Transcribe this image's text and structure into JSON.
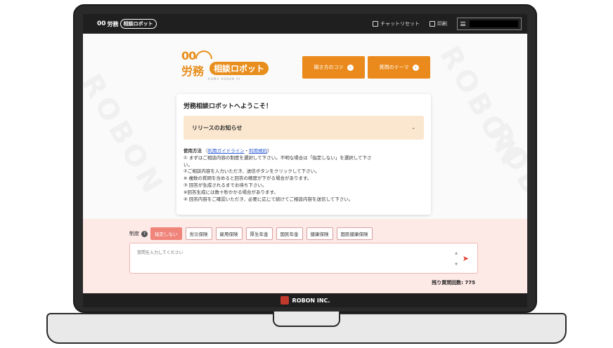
{
  "header": {
    "logo_oo": "00",
    "logo_word": "労務",
    "logo_pill": "相談ロボット",
    "reset_label": "チャットリセット",
    "print_label": "印刷"
  },
  "hero": {
    "logo_oo": "00",
    "logo_word": "労務",
    "logo_pill": "相談ロボット",
    "logo_sub": "ROMU SODAN AI",
    "tips_button": "聞き方のコツ",
    "themes_button": "質問のテーマ"
  },
  "card": {
    "welcome": "労務相談ロボットへようこそ！",
    "release_title": "リリースのお知らせ",
    "usage_title": "使用方法",
    "usage_link1": "利用ガイドライン",
    "usage_sep": "・",
    "usage_link2": "利用規約",
    "lines": [
      "① まずはご相談内容の制度を選択して下さい。不明な場合は「指定しない」を選択して下さ",
      "い。",
      "②ご相談内容を入力いただき、送信ボタンをクリックして下さい。",
      "※ 複数の質問を含めると回答の精度が下がる場合があります。",
      "③ 回答が生成されるまでお待ち下さい。",
      "※回答生成には数十秒かかる場合があります。",
      "④ 回答内容をご確認いただき、必要に応じて続けてご相談内容を送信して下さい。"
    ]
  },
  "filters": {
    "label": "制度",
    "options": [
      "指定しない",
      "労災保険",
      "雇用保険",
      "厚生年金",
      "国民年金",
      "健康保険",
      "国民健康保険"
    ]
  },
  "question": {
    "placeholder": "質問を入力してください"
  },
  "remaining": "残り質問回数: 775",
  "footer": {
    "company": "ROBON INC."
  },
  "watermark": "ROBON",
  "colors": {
    "accent": "#ea8a1c",
    "active_chip": "#f0837a",
    "pink_bg": "#fde9e6",
    "dark": "#1f1f1f"
  }
}
